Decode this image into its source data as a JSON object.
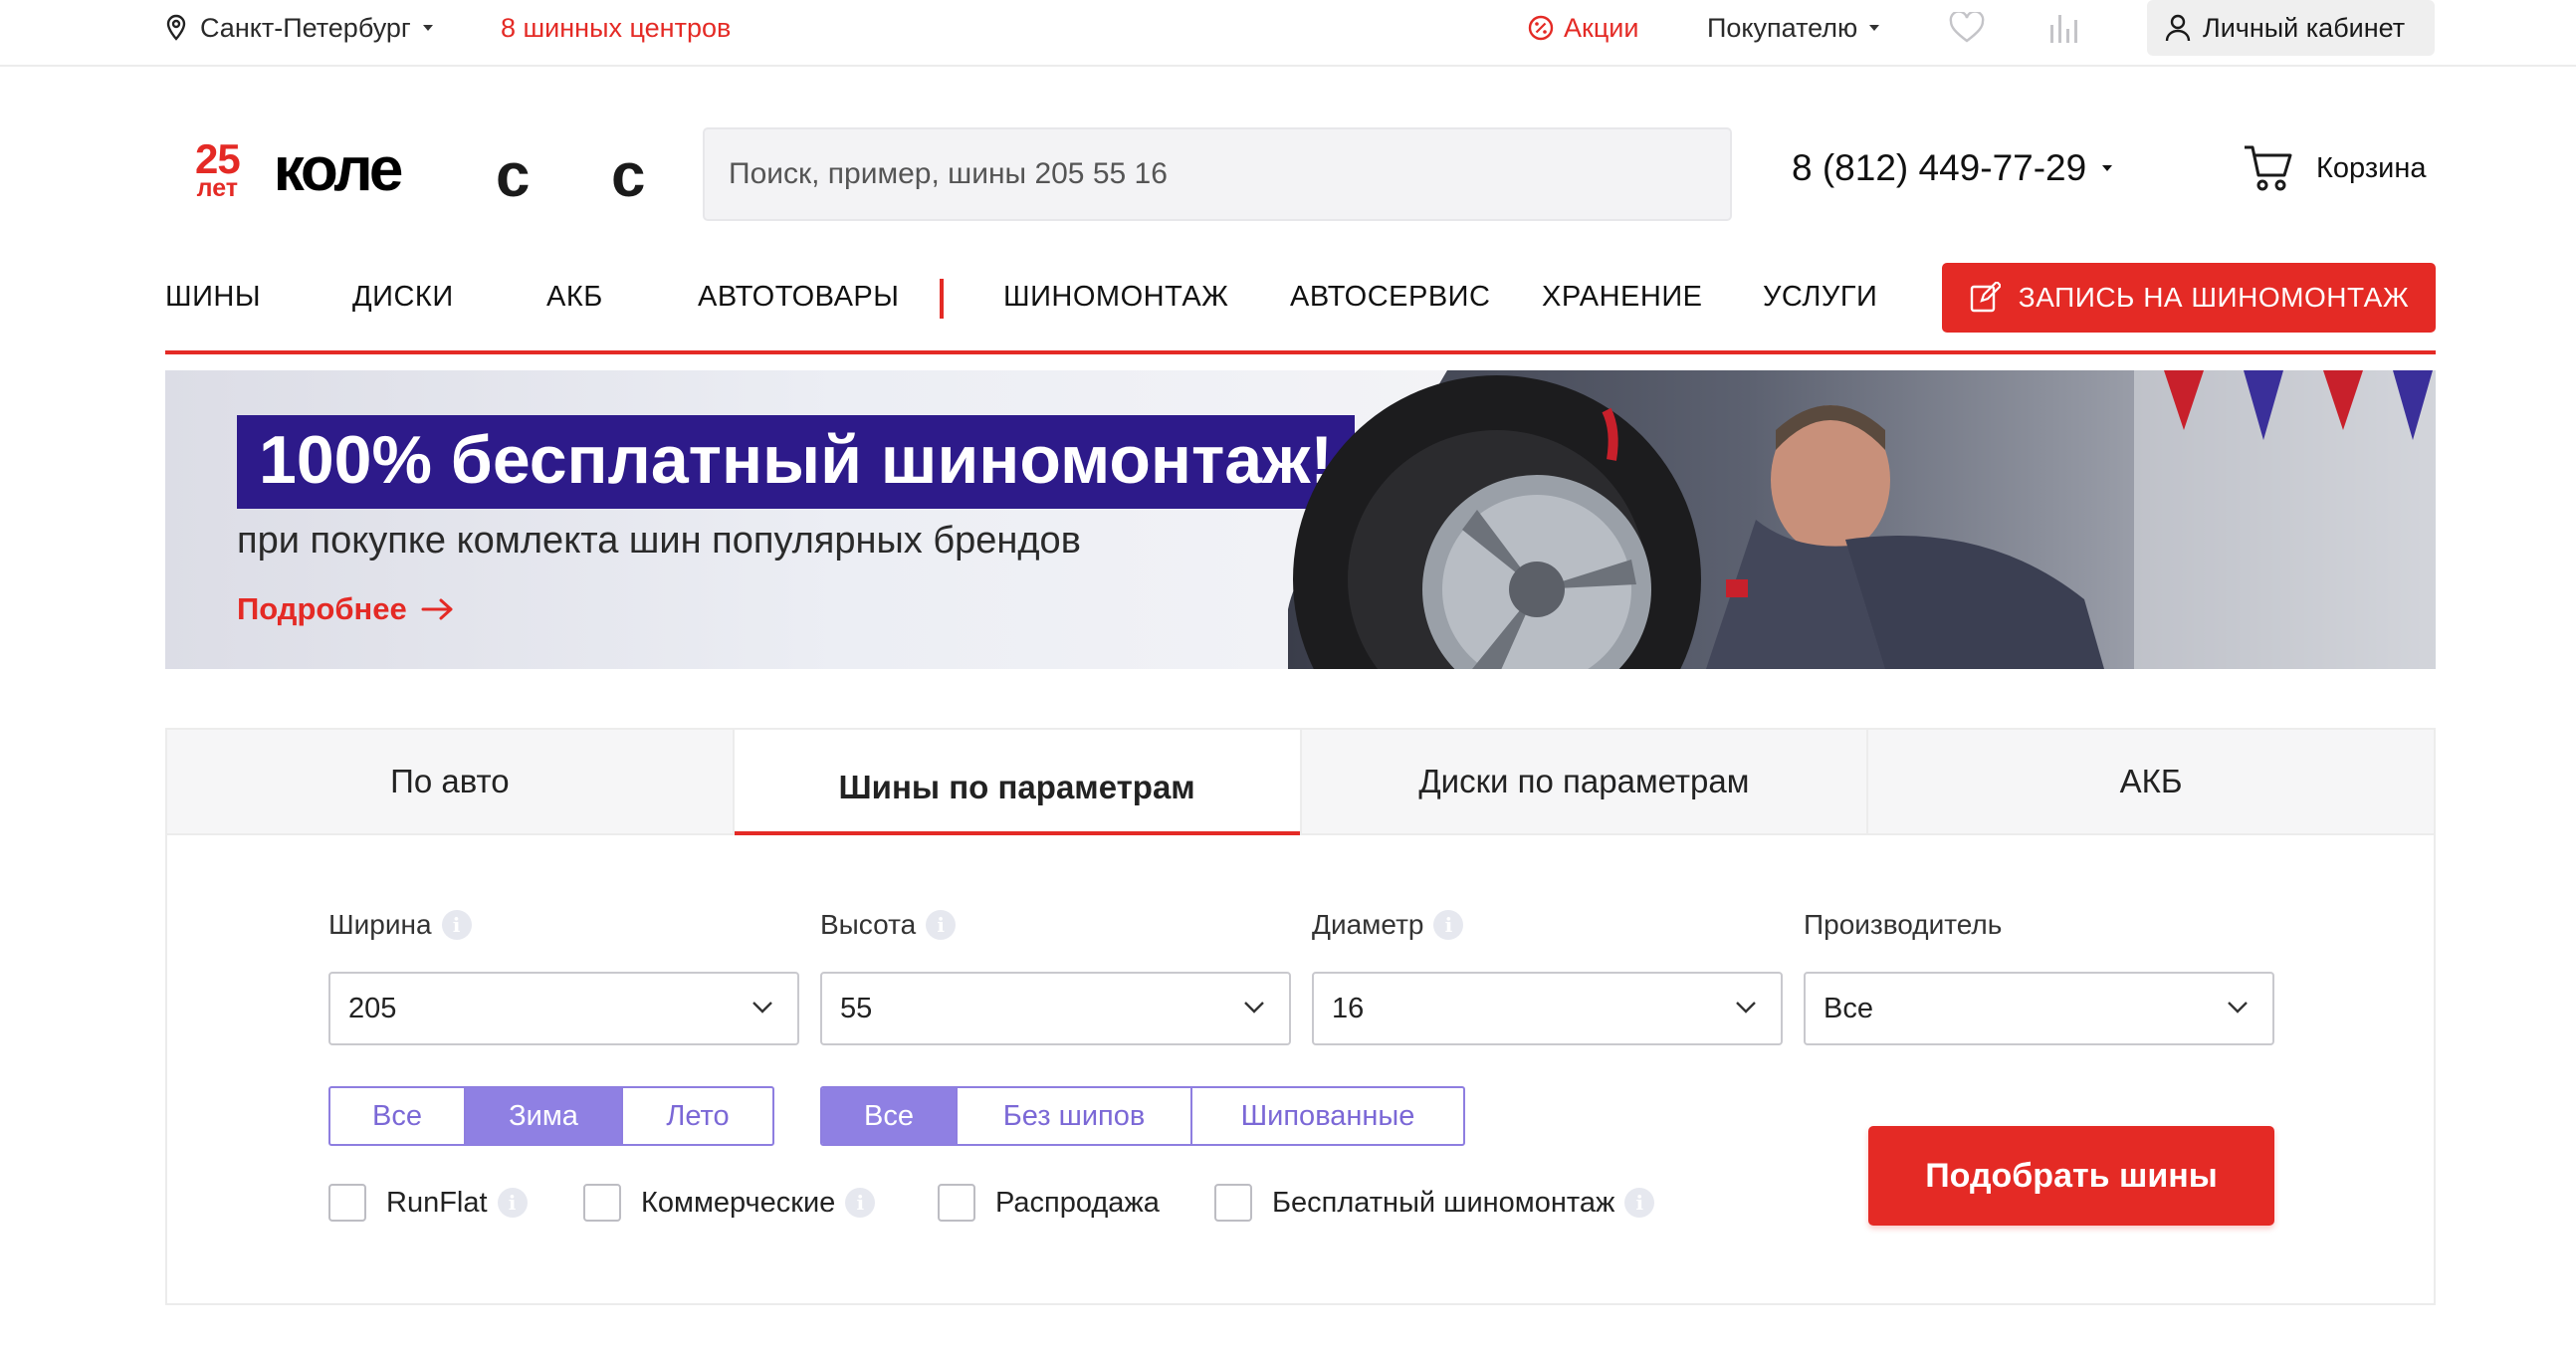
{
  "topbar": {
    "city": "Санкт-Петербург",
    "centers": "8 шинных центров",
    "promo": "Акции",
    "buyer": "Покупателю",
    "cabinet": "Личный кабинет"
  },
  "header": {
    "logo_years": "25",
    "logo_years_unit": "лет",
    "logo_word": "коле",
    "logo_c1": "с",
    "logo_c2": "с",
    "search_placeholder": "Поиск, пример, шины 205 55 16",
    "phone": "8 (812) 449-77-29",
    "cart": "Корзина"
  },
  "nav": {
    "items": [
      "ШИНЫ",
      "ДИСКИ",
      "АКБ",
      "АВТОТОВАРЫ",
      "ШИНОМОНТАЖ",
      "АВТОСЕРВИС",
      "ХРАНЕНИЕ",
      "УСЛУГИ"
    ],
    "cta": "ЗАПИСЬ НА ШИНОМОНТАЖ"
  },
  "banner": {
    "title": "100% бесплатный шиномонтаж!",
    "subtitle": "при покупке комлекта шин популярных брендов",
    "more": "Подробнее"
  },
  "selector": {
    "tabs": [
      "По авто",
      "Шины по параметрам",
      "Диски по параметрам",
      "АКБ"
    ],
    "active_tab": "Шины по параметрам",
    "fields": [
      {
        "label": "Ширина",
        "value": "205"
      },
      {
        "label": "Высота",
        "value": "55"
      },
      {
        "label": "Диаметр",
        "value": "16"
      },
      {
        "label": "Производитель",
        "value": "Все"
      }
    ],
    "season": [
      "Все",
      "Зима",
      "Лето"
    ],
    "season_selected": "Зима",
    "spikes": [
      "Все",
      "Без шипов",
      "Шипованные"
    ],
    "spikes_selected": "Все",
    "checkboxes": [
      "RunFlat",
      "Коммерческие",
      "Распродажа",
      "Бесплатный шиномонтаж"
    ],
    "info_glyph": "i",
    "submit": "Подобрать шины"
  },
  "colors": {
    "brand_red": "#e42a25",
    "banner_purple": "#2d1a8a",
    "segment_purple": "#8f80e3"
  }
}
